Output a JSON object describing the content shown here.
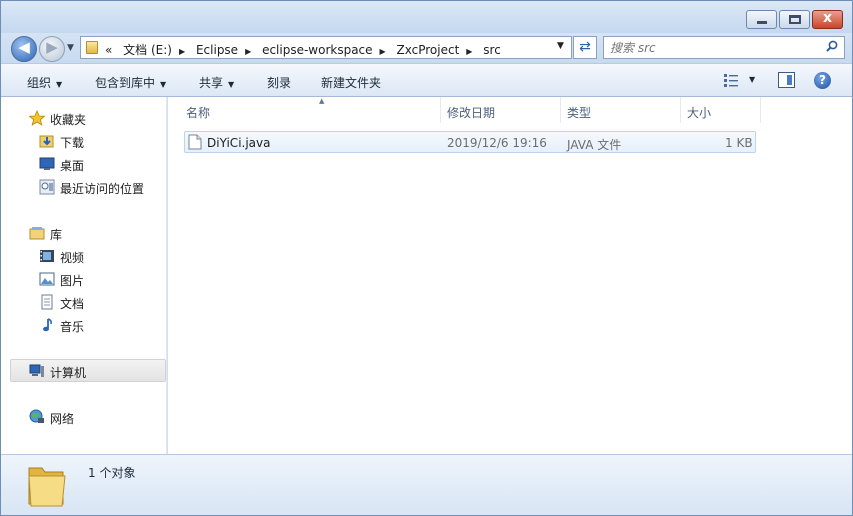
{
  "window": {
    "controls": {
      "min": "",
      "max": "",
      "close": "x"
    }
  },
  "address": {
    "crumbs_prefix": "«",
    "crumbs": [
      "文档 (E:)",
      "Eclipse",
      "eclipse-workspace",
      "ZxcProject",
      "src"
    ],
    "search_placeholder": "搜索 src"
  },
  "toolbar": {
    "organize": "组织",
    "include_in_library": "包含到库中",
    "share": "共享",
    "burn": "刻录",
    "new_folder": "新建文件夹",
    "help": "?"
  },
  "nav": {
    "favorites": "收藏夹",
    "downloads": "下载",
    "desktop": "桌面",
    "recent": "最近访问的位置",
    "libraries": "库",
    "videos": "视频",
    "pictures": "图片",
    "documents": "文档",
    "music": "音乐",
    "computer": "计算机",
    "network": "网络"
  },
  "columns": {
    "name": "名称",
    "modified": "修改日期",
    "type": "类型",
    "size": "大小"
  },
  "files": [
    {
      "name": "DiYiCi.java",
      "modified": "2019/12/6 19:16",
      "type": "JAVA 文件",
      "size": "1 KB"
    }
  ],
  "status": {
    "count": "1 个对象"
  },
  "colors": {
    "accent": "#2b63b6",
    "selection": "#e6f0fb",
    "frame": "#cfe0f3"
  }
}
